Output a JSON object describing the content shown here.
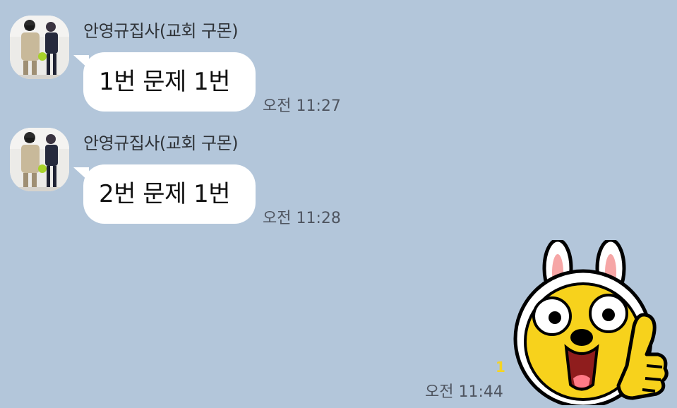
{
  "messages": [
    {
      "sender": "안영규집사(교회 구몬)",
      "text": "1번 문제 1번",
      "time": "오전 11:27"
    },
    {
      "sender": "안영규집사(교회 구몬)",
      "text": "2번 문제 1번",
      "time": "오전 11:28"
    }
  ],
  "my_message": {
    "type": "sticker",
    "sticker_icon": "bunny-thumbs-up-sticker-icon",
    "unread_count": "1",
    "time": "오전 11:44"
  },
  "colors": {
    "background": "#b3c6da",
    "bubble": "#ffffff",
    "unread": "#f5d423"
  }
}
